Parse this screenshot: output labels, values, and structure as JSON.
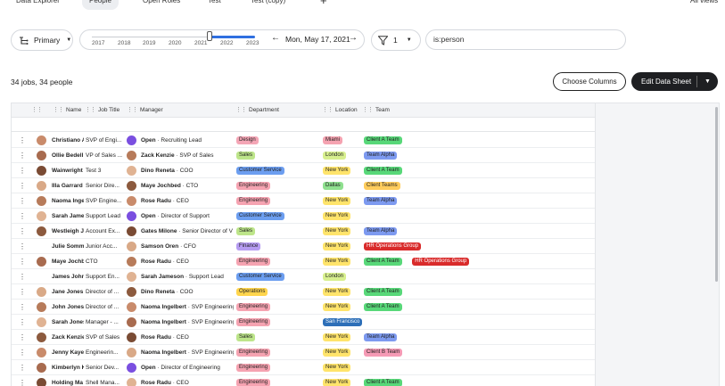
{
  "tabs": [
    "Data Explorer",
    "People",
    "Open Roles",
    "Test",
    "Test (copy)",
    "+",
    "All views"
  ],
  "toolbar": {
    "primary_label": "Primary",
    "years": [
      "2017",
      "2018",
      "2019",
      "2020",
      "2021",
      "2022",
      "2023"
    ],
    "date_label": "Mon, May 17, 2021",
    "filter_count": "1",
    "search_value": "is:person"
  },
  "summary": "34 jobs, 34 people",
  "buttons": {
    "choose_columns": "Choose Columns",
    "edit_data_sheet": "Edit Data Sheet"
  },
  "columns": [
    "Name",
    "Job Title",
    "Manager",
    "Department",
    "Location",
    "Team"
  ],
  "colors": {
    "Design": "#f4a6b6",
    "Sales": "#bde58a",
    "Customer Service": "#6c9ef0",
    "Engineering": "#f5a3b1",
    "Finance": "#b69cf2",
    "Operations": "#ffd54d",
    "Miami": "#f5a3b1",
    "London": "#d7ef8e",
    "New York": "#ffe46b",
    "Dallas": "#8fe08f",
    "San Francisco": "#2d6fb8",
    "Client A Team": "#58d879",
    "Team Alpha": "#7d9af0",
    "Client Teams": "#ffcc5c",
    "HR Operations Group": "#d92b2b",
    "Client B Team": "#f59ab5"
  },
  "rows": [
    {
      "name": "Christiano A",
      "title": "SVP of Engi...",
      "manager": "Open",
      "manager_role": "· Recruiting Lead",
      "open": true,
      "dept": "Design",
      "loc": "Miami",
      "teams": [
        "Client A Team"
      ]
    },
    {
      "name": "Ollie Bedell",
      "title": "VP of Sales ...",
      "manager": "Zack Kenzie",
      "manager_role": "· SVP of Sales",
      "dept": "Sales",
      "loc": "London",
      "teams": [
        "Team Alpha"
      ]
    },
    {
      "name": "Wainwright",
      "title": "Test 3",
      "manager": "Dino Reneta",
      "manager_role": "· COO",
      "dept": "Customer Service",
      "loc": "New York",
      "teams": [
        "Client A Team"
      ]
    },
    {
      "name": "Illa Garrard",
      "title": "Senior Dire...",
      "manager": "Maye Jochbed",
      "manager_role": "· CTO",
      "dept": "Engineering",
      "loc": "Dallas",
      "teams": [
        "Client Teams"
      ]
    },
    {
      "name": "Naoma Inge",
      "title": "SVP Engine...",
      "manager": "Rose Radu",
      "manager_role": "· CEO",
      "dept": "Engineering",
      "loc": "New York",
      "teams": [
        "Team Alpha"
      ]
    },
    {
      "name": "Sarah Jame",
      "title": "Support Lead",
      "manager": "Open",
      "manager_role": "· Director of Support",
      "open": true,
      "dept": "Customer Service",
      "loc": "New York",
      "teams": []
    },
    {
      "name": "Westleigh J",
      "title": "Account Ex...",
      "manager": "Gates Milone",
      "manager_role": "· Senior Director of V",
      "dept": "Sales",
      "loc": "New York",
      "teams": [
        "Team Alpha"
      ]
    },
    {
      "name": "Julie Somm",
      "title": "Junior Acc...",
      "manager": "Samson Oren",
      "manager_role": "· CFO",
      "dept": "Finance",
      "loc": "New York",
      "teams": [
        "HR Operations Group"
      ],
      "noavatar": true
    },
    {
      "name": "Maye Jochb",
      "title": "CTO",
      "manager": "Rose Radu",
      "manager_role": "· CEO",
      "dept": "Engineering",
      "loc": "New York",
      "teams": [
        "Client A Team",
        "HR Operations Group"
      ]
    },
    {
      "name": "James John",
      "title": "Support En...",
      "manager": "Sarah Jameson",
      "manager_role": "· Support Lead",
      "dept": "Customer Service",
      "loc": "London",
      "teams": [],
      "noavatar": true
    },
    {
      "name": "Jane Jones",
      "title": "Director of ...",
      "manager": "Dino Reneta",
      "manager_role": "· COO",
      "dept": "Operations",
      "loc": "New York",
      "teams": [
        "Client A Team"
      ]
    },
    {
      "name": "John Jones",
      "title": "Director of ...",
      "manager": "Naoma Ingelbert",
      "manager_role": "· SVP Engineering",
      "dept": "Engineering",
      "loc": "New York",
      "teams": [
        "Client A Team"
      ]
    },
    {
      "name": "Sarah Jones",
      "title": "Manager - ...",
      "manager": "Naoma Ingelbert",
      "manager_role": "· SVP Engineering",
      "dept": "Engineering",
      "loc": "San Francisco",
      "teams": []
    },
    {
      "name": "Zack Kenzie",
      "title": "SVP of Sales",
      "manager": "Rose Radu",
      "manager_role": "· CEO",
      "dept": "Sales",
      "loc": "New York",
      "teams": [
        "Team Alpha"
      ]
    },
    {
      "name": "Jenny Kaye",
      "title": "Engineerin...",
      "manager": "Naoma Ingelbert",
      "manager_role": "· SVP Engineering",
      "dept": "Engineering",
      "loc": "New York",
      "teams": [
        "Client B Team"
      ]
    },
    {
      "name": "Kimberlyn K",
      "title": "Senior Dev...",
      "manager": "Open",
      "manager_role": "· Director of Engineering",
      "open": true,
      "dept": "Engineering",
      "loc": "New York",
      "teams": []
    },
    {
      "name": "Holding Ma",
      "title": "Shell Mana...",
      "manager": "Rose Radu",
      "manager_role": "· CEO",
      "dept": "Engineering",
      "loc": "New York",
      "teams": [
        "Client A Team"
      ]
    }
  ]
}
